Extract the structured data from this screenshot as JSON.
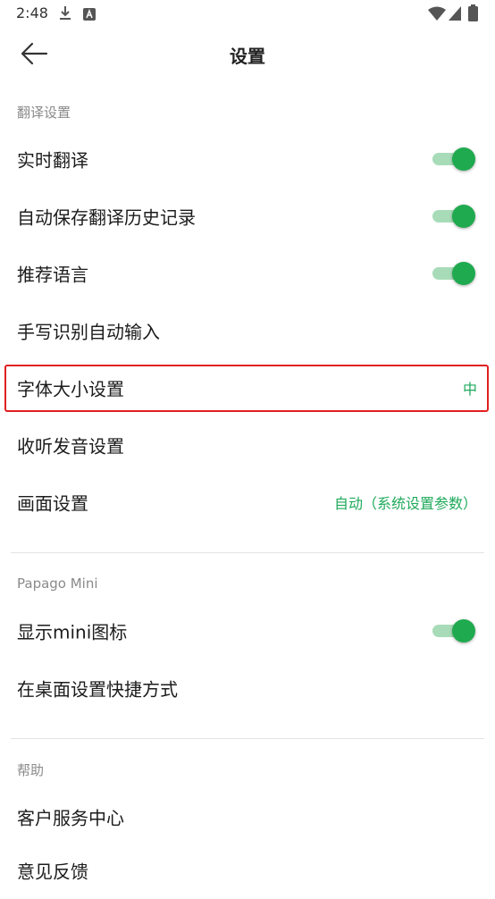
{
  "status_bar": {
    "time": "2:48",
    "icons": [
      "download-icon",
      "a-notification-icon",
      "wifi-icon",
      "cellular-icon",
      "battery-icon"
    ]
  },
  "app_bar": {
    "title": "设置",
    "back_icon": "arrow-left-icon"
  },
  "colors": {
    "accent": "#1faa4f",
    "highlight_border": "#e02020"
  },
  "sections": [
    {
      "header": "翻译设置",
      "items": [
        {
          "label": "实时翻译",
          "toggle": true
        },
        {
          "label": "自动保存翻译历史记录",
          "toggle": true
        },
        {
          "label": "推荐语言",
          "toggle": true
        },
        {
          "label": "手写识别自动输入"
        },
        {
          "label": "字体大小设置",
          "value": "中",
          "highlighted": true
        },
        {
          "label": "收听发音设置"
        },
        {
          "label": "画面设置",
          "value": "自动（系统设置参数）"
        }
      ]
    },
    {
      "header": "Papago Mini",
      "items": [
        {
          "label": "显示mini图标",
          "toggle": true
        },
        {
          "label": "在桌面设置快捷方式"
        }
      ]
    },
    {
      "header": "帮助",
      "items": [
        {
          "label": "客户服务中心"
        },
        {
          "label": "意见反馈"
        }
      ]
    }
  ]
}
